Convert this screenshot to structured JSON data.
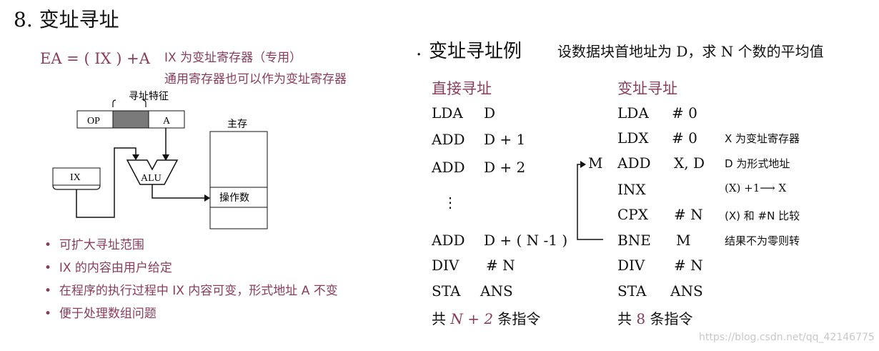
{
  "heading": "8. 变址寻址",
  "left": {
    "formula": "EA = ( IX ) +A",
    "note1": "IX 为变址寄存器（专用）",
    "note2": "通用寄存器也可以作为变址寄存器",
    "diagram": {
      "feature_label": "寻址特征",
      "op": "OP",
      "a": "A",
      "ix": "IX",
      "alu": "ALU",
      "memory_label": "主存",
      "operand": "操作数"
    },
    "bullets": [
      "可扩大寻址范围",
      "IX 的内容由用户给定",
      "在程序的执行过程中 IX 内容可变，形式地址 A 不变",
      "便于处理数组问题"
    ]
  },
  "right": {
    "title_prefix": ".",
    "title": "变址寻址例",
    "problem": "设数据块首地址为 D，求 N 个数的平均值",
    "direct": {
      "header": "直接寻址",
      "lines": [
        {
          "op": "LDA",
          "arg": "D"
        },
        {
          "op": "ADD",
          "arg": "D + 1"
        },
        {
          "op": "ADD",
          "arg": "D + 2"
        },
        {
          "op": "⋮",
          "arg": ""
        },
        {
          "op": "ADD",
          "arg": "D + ( N -1 )"
        },
        {
          "op": "DIV",
          "arg": "# N"
        },
        {
          "op": "STA",
          "arg": "ANS"
        }
      ],
      "total_prefix": "共",
      "total_value": "N + 2",
      "total_suffix": "条指令"
    },
    "indexed": {
      "header": "变址寻址",
      "label_m": "M",
      "lines": [
        {
          "op": "LDA",
          "arg": "# 0",
          "comment": ""
        },
        {
          "op": "LDX",
          "arg": "# 0",
          "comment": "X 为变址寄存器"
        },
        {
          "op": "ADD",
          "arg": "X, D",
          "comment": "D 为形式地址"
        },
        {
          "op": "INX",
          "arg": "",
          "comment": "(X) +1⟶ X"
        },
        {
          "op": "CPX",
          "arg": "# N",
          "comment": "(X) 和 #N 比较"
        },
        {
          "op": "BNE",
          "arg": "M",
          "comment": "结果不为零则转"
        },
        {
          "op": "DIV",
          "arg": "# N",
          "comment": ""
        },
        {
          "op": "STA",
          "arg": "ANS",
          "comment": ""
        }
      ],
      "total_prefix": "共",
      "total_value": "8",
      "total_suffix": "条指令"
    }
  },
  "watermark": "https://blog.csdn.net/qq_42146775",
  "colors": {
    "accent": "#8a3c5c",
    "text": "#111111",
    "field_fill": "#7a7a7a"
  }
}
